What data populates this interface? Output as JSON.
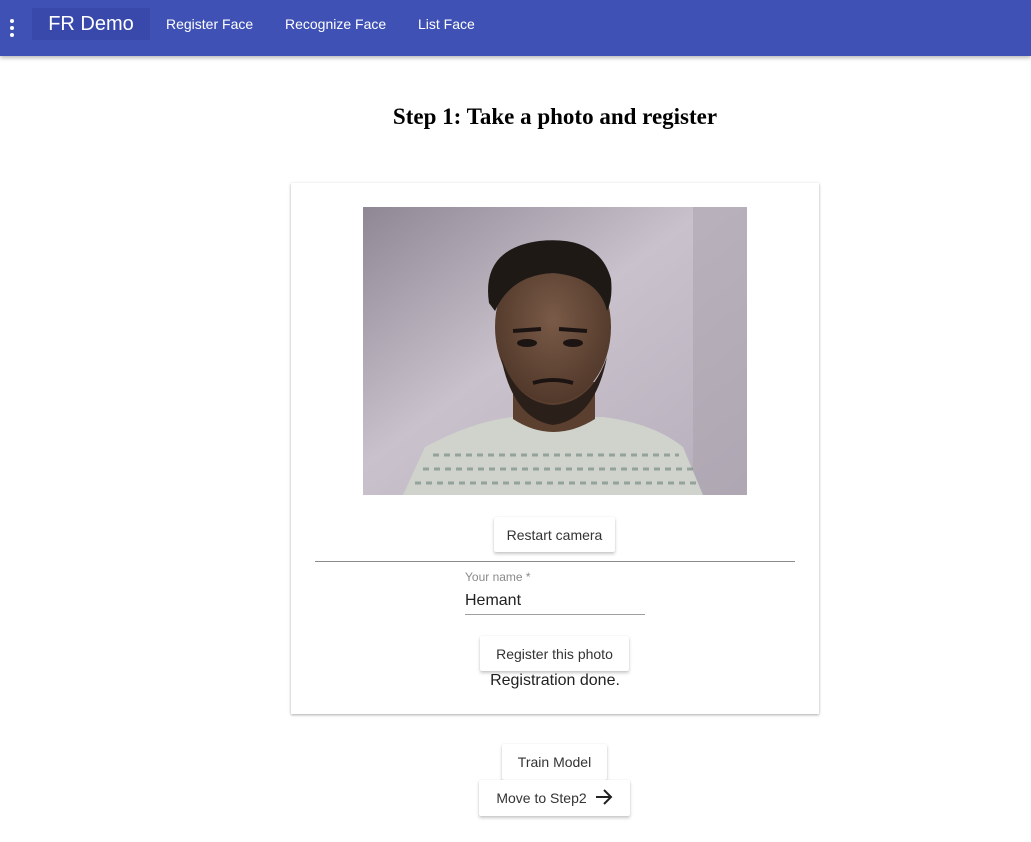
{
  "app": {
    "brand": "FR Demo",
    "nav": [
      "Register Face",
      "Recognize Face",
      "List Face"
    ],
    "accent_color": "#3f51b5"
  },
  "page": {
    "title": "Step 1: Take a photo and register"
  },
  "card": {
    "restart_label": "Restart camera",
    "name_label": "Your name *",
    "name_value": "Hemant",
    "register_label": "Register this photo",
    "status": "Registration done."
  },
  "actions": {
    "train_label": "Train Model",
    "step2_label": "Move to Step2",
    "step2_icon": "arrow-right-icon"
  }
}
